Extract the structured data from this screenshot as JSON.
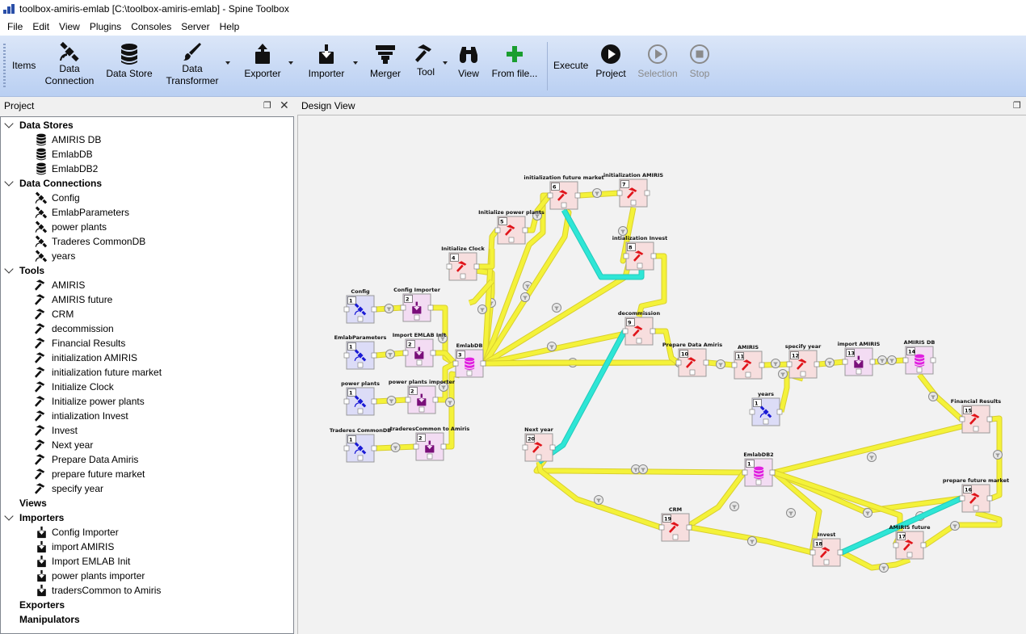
{
  "window": {
    "title": "toolbox-amiris-emlab [C:\\toolbox-amiris-emlab] - Spine Toolbox"
  },
  "menu": [
    "File",
    "Edit",
    "View",
    "Plugins",
    "Consoles",
    "Server",
    "Help"
  ],
  "toolbar": {
    "items_label": "Items",
    "data_connection": "Data\nConnection",
    "data_store": "Data Store",
    "data_transformer": "Data\nTransformer",
    "exporter": "Exporter",
    "importer": "Importer",
    "merger": "Merger",
    "tool": "Tool",
    "view": "View",
    "from_file": "From file...",
    "execute_label": "Execute",
    "project": "Project",
    "selection": "Selection",
    "stop": "Stop"
  },
  "project_panel": {
    "title": "Project",
    "categories": [
      {
        "name": "Data Stores",
        "expanded": true,
        "icon": "database-icon",
        "items": [
          "AMIRIS DB",
          "EmlabDB",
          "EmlabDB2"
        ]
      },
      {
        "name": "Data Connections",
        "expanded": true,
        "icon": "satellite-icon",
        "items": [
          "Config",
          "EmlabParameters",
          "power plants",
          "Traderes CommonDB",
          "years"
        ]
      },
      {
        "name": "Tools",
        "expanded": true,
        "icon": "hammer-icon",
        "items": [
          "AMIRIS",
          "AMIRIS future",
          "CRM",
          "decommission",
          "Financial Results",
          "initialization AMIRIS",
          "initialization future market",
          "Initialize Clock",
          "Initialize power plants",
          "intialization Invest",
          "Invest",
          "Next year",
          "Prepare Data Amiris",
          "prepare future market",
          "specify year"
        ]
      },
      {
        "name": "Views",
        "expanded": false,
        "icon": "",
        "items": []
      },
      {
        "name": "Importers",
        "expanded": true,
        "icon": "importer-icon",
        "items": [
          "Config Importer",
          "import AMIRIS",
          "Import EMLAB Init",
          "power plants importer",
          "tradersCommon to Amiris"
        ]
      },
      {
        "name": "Exporters",
        "expanded": false,
        "icon": "",
        "items": []
      },
      {
        "name": "Manipulators",
        "expanded": false,
        "icon": "",
        "items": []
      }
    ]
  },
  "design_view": {
    "title": "Design View",
    "nodes": [
      {
        "id": "config",
        "label": "Config",
        "type": "dc",
        "num": "1"
      },
      {
        "id": "config_imp",
        "label": "Config Importer",
        "type": "importer",
        "num": "2"
      },
      {
        "id": "emlabparams",
        "label": "EmlabParameters",
        "type": "dc",
        "num": "1"
      },
      {
        "id": "import_emlab",
        "label": "Import EMLAB Init",
        "type": "importer",
        "num": "2"
      },
      {
        "id": "pp",
        "label": "power plants",
        "type": "dc",
        "num": "1"
      },
      {
        "id": "pp_imp",
        "label": "power plants importer",
        "type": "importer",
        "num": "2"
      },
      {
        "id": "traderes",
        "label": "Traderes CommonDB",
        "type": "dc",
        "num": "1"
      },
      {
        "id": "traderes_imp",
        "label": "traderesCommon to Amiris",
        "type": "importer",
        "num": "2"
      },
      {
        "id": "emlabdb",
        "label": "EmlabDB",
        "type": "ds",
        "num": "3"
      },
      {
        "id": "init_clock",
        "label": "Initialize Clock",
        "type": "tool",
        "num": "4"
      },
      {
        "id": "init_pp",
        "label": "Initialize power plants",
        "type": "tool",
        "num": "5"
      },
      {
        "id": "init_future",
        "label": "initialization future market",
        "type": "tool",
        "num": "6"
      },
      {
        "id": "init_amiris",
        "label": "initialization AMIRIS",
        "type": "tool",
        "num": "7"
      },
      {
        "id": "init_invest",
        "label": "intialization Invest",
        "type": "tool",
        "num": "8"
      },
      {
        "id": "decommission",
        "label": "decommission",
        "type": "tool",
        "num": "9"
      },
      {
        "id": "prep_data",
        "label": "Prepare Data Amiris",
        "type": "tool",
        "num": "10"
      },
      {
        "id": "amiris",
        "label": "AMIRIS",
        "type": "tool",
        "num": "11"
      },
      {
        "id": "specify_year",
        "label": "specify year",
        "type": "tool",
        "num": "12"
      },
      {
        "id": "import_amiris",
        "label": "import AMIRIS",
        "type": "importer",
        "num": "13"
      },
      {
        "id": "amirisdb",
        "label": "AMIRIS DB",
        "type": "ds",
        "num": "14"
      },
      {
        "id": "years",
        "label": "years",
        "type": "dc",
        "num": "1"
      },
      {
        "id": "fin_results",
        "label": "Financial Results",
        "type": "tool",
        "num": "15"
      },
      {
        "id": "prep_future",
        "label": "prepare future market",
        "type": "tool",
        "num": "16"
      },
      {
        "id": "amiris_future",
        "label": "AMIRIS future",
        "type": "tool",
        "num": "17"
      },
      {
        "id": "invest",
        "label": "Invest",
        "type": "tool",
        "num": "18"
      },
      {
        "id": "crm",
        "label": "CRM",
        "type": "tool",
        "num": "19"
      },
      {
        "id": "next_year",
        "label": "Next year",
        "type": "tool",
        "num": "20"
      },
      {
        "id": "emlabdb2",
        "label": "EmlabDB2",
        "type": "ds",
        "num": "1"
      }
    ]
  },
  "colors": {
    "link": "#f4f23a",
    "link_border": "#d9cf2e",
    "loop": "#2ee6d6",
    "tool_bg": "#f7dede",
    "dc_bg": "#dcdcf7",
    "ds_bg": "#f3dcf3",
    "importer_bg": "#f3dcf3"
  }
}
